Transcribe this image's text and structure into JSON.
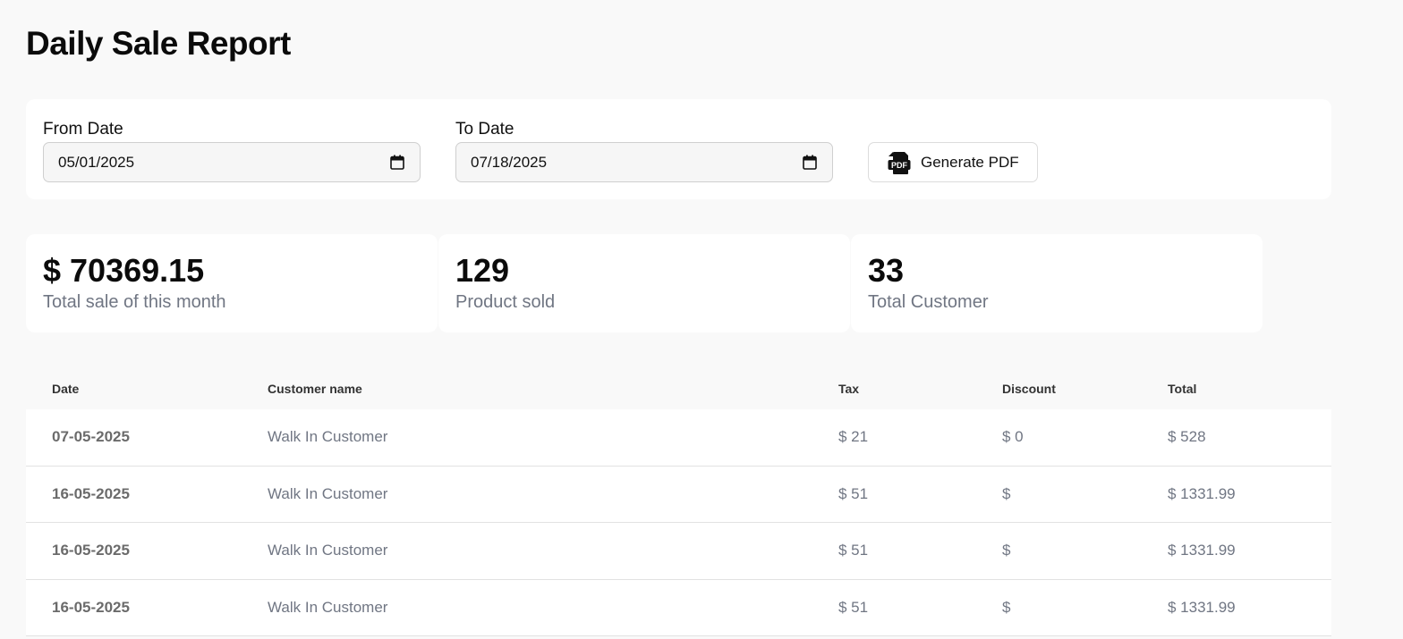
{
  "page": {
    "title": "Daily Sale Report"
  },
  "filters": {
    "from_label": "From Date",
    "from_value": "05/01/2025",
    "to_label": "To Date",
    "to_value": "07/18/2025",
    "generate_label": "Generate PDF",
    "pdf_icon_text": "PDF"
  },
  "stats": [
    {
      "value": "$ 70369.15",
      "label": "Total sale of this month"
    },
    {
      "value": "129",
      "label": "Product sold"
    },
    {
      "value": "33",
      "label": "Total Customer"
    }
  ],
  "table": {
    "headers": {
      "date": "Date",
      "customer": "Customer name",
      "tax": "Tax",
      "discount": "Discount",
      "total": "Total"
    },
    "rows": [
      {
        "date": "07-05-2025",
        "customer": "Walk In Customer",
        "tax": "$ 21",
        "discount": "$ 0",
        "total": "$ 528"
      },
      {
        "date": "16-05-2025",
        "customer": "Walk In Customer",
        "tax": "$ 51",
        "discount": "$",
        "total": "$ 1331.99"
      },
      {
        "date": "16-05-2025",
        "customer": "Walk In Customer",
        "tax": "$ 51",
        "discount": "$",
        "total": "$ 1331.99"
      },
      {
        "date": "16-05-2025",
        "customer": "Walk In Customer",
        "tax": "$ 51",
        "discount": "$",
        "total": "$ 1331.99"
      }
    ]
  },
  "icons": {
    "calendar": "calendar-icon",
    "pdf": "pdf-file-icon"
  }
}
